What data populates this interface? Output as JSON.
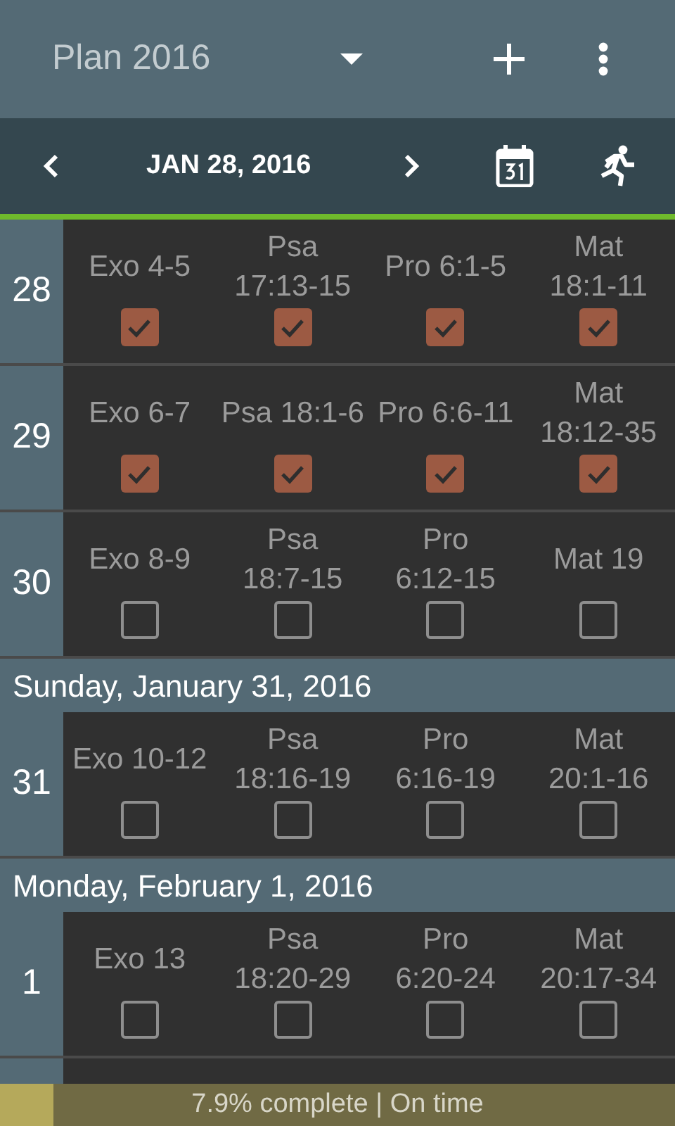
{
  "toolbar": {
    "title": "Plan 2016"
  },
  "date_bar": {
    "date": "JAN 28, 2016"
  },
  "rows": [
    {
      "kind": "day",
      "day": "28",
      "readings": [
        {
          "text": "Exo 4-5",
          "checked": true
        },
        {
          "text": "Psa 17:13-15",
          "checked": true
        },
        {
          "text": "Pro 6:1-5",
          "checked": true
        },
        {
          "text": "Mat 18:1-11",
          "checked": true
        }
      ]
    },
    {
      "kind": "day",
      "day": "29",
      "readings": [
        {
          "text": "Exo 6-7",
          "checked": true
        },
        {
          "text": "Psa 18:1-6",
          "checked": true
        },
        {
          "text": "Pro 6:6-11",
          "checked": true
        },
        {
          "text": "Mat 18:12-35",
          "checked": true
        }
      ]
    },
    {
      "kind": "day",
      "day": "30",
      "readings": [
        {
          "text": "Exo 8-9",
          "checked": false
        },
        {
          "text": "Psa 18:7-15",
          "checked": false
        },
        {
          "text": "Pro 6:12-15",
          "checked": false
        },
        {
          "text": "Mat 19",
          "checked": false
        }
      ]
    },
    {
      "kind": "header",
      "text": "Sunday, January 31, 2016"
    },
    {
      "kind": "day",
      "day": "31",
      "readings": [
        {
          "text": "Exo 10-12",
          "checked": false
        },
        {
          "text": "Psa 18:16-19",
          "checked": false
        },
        {
          "text": "Pro 6:16-19",
          "checked": false
        },
        {
          "text": "Mat 20:1-16",
          "checked": false
        }
      ]
    },
    {
      "kind": "header",
      "text": "Monday, February 1, 2016"
    },
    {
      "kind": "day",
      "day": "1",
      "readings": [
        {
          "text": "Exo 13",
          "checked": false
        },
        {
          "text": "Psa 18:20-29",
          "checked": false
        },
        {
          "text": "Pro 6:20-24",
          "checked": false
        },
        {
          "text": "Mat 20:17-34",
          "checked": false
        }
      ]
    }
  ],
  "progress": {
    "level": 0.079,
    "text": "7.9% complete | On time"
  }
}
